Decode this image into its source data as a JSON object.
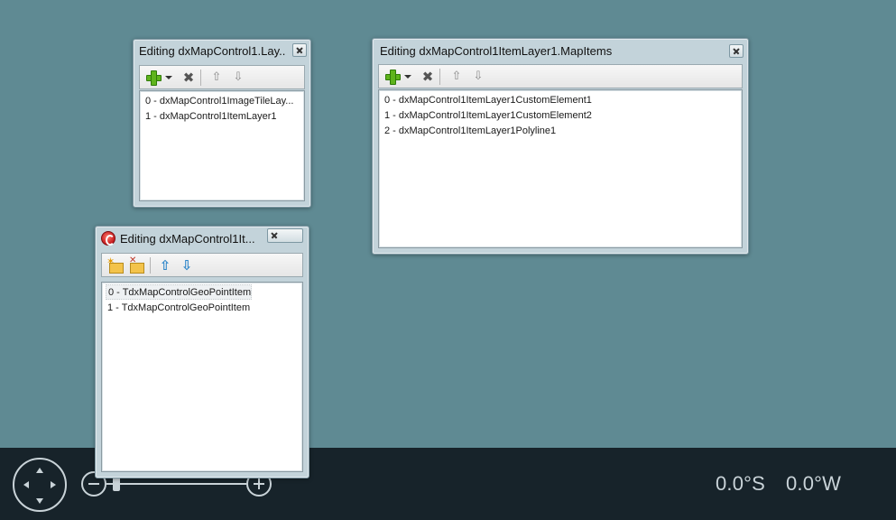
{
  "windows": {
    "layers": {
      "title": "Editing dxMapControl1.Lay...",
      "items": [
        "0 - dxMapControl1ImageTileLay...",
        "1 - dxMapControl1ItemLayer1"
      ]
    },
    "map_items": {
      "title": "Editing dxMapControl1ItemLayer1.MapItems",
      "items": [
        "0 - dxMapControl1ItemLayer1CustomElement1",
        "1 - dxMapControl1ItemLayer1CustomElement2",
        "2 - dxMapControl1ItemLayer1Polyline1"
      ]
    },
    "geo_items": {
      "title": "Editing dxMapControl1It...",
      "items": [
        "0 - TdxMapControlGeoPointItem",
        "1 - TdxMapControlGeoPointItem"
      ]
    }
  },
  "icons": {
    "add": "plus-icon",
    "add_dropdown": "dropdown-arrow-icon",
    "delete": "delete-icon",
    "move_up": "arrow-up-icon",
    "move_down": "arrow-down-icon",
    "add_folder": "folder-add-icon",
    "delete_folder": "folder-delete-icon",
    "app": "delphi-app-icon",
    "navigation": "pan-navigation-icon",
    "zoom_in": "zoom-in-icon",
    "zoom_out": "zoom-out-icon"
  },
  "icon_glyphs": {
    "delete": "✖",
    "move_up_gray": "⇧",
    "move_down_gray": "⇩",
    "move_up_blue": "⇧",
    "move_down_blue": "⇩"
  },
  "map_nav": {
    "latitude": "0.0°S",
    "longitude": "0.0°W"
  },
  "colors": {
    "map_background": "#5f8a93",
    "nav_bar": "#17232a",
    "nav_foreground": "#c9d3d8",
    "add_green": "#5fb41c",
    "arrow_blue": "#2e86c9"
  }
}
